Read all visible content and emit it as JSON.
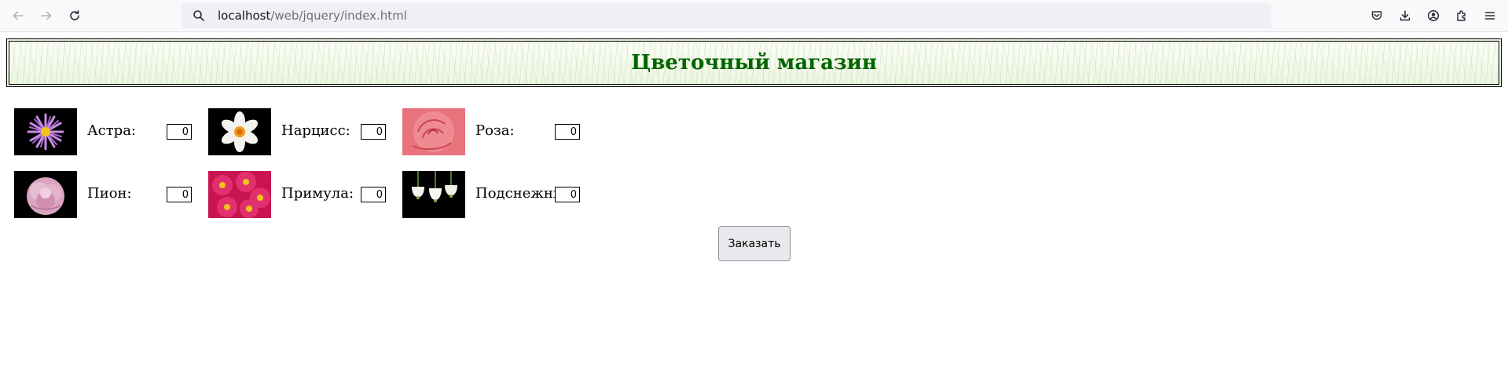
{
  "browser": {
    "url_host": "localhost",
    "url_path": "/web/jquery/index.html",
    "icons": [
      "back-arrow-icon",
      "forward-arrow-icon",
      "reload-icon",
      "search-icon",
      "pocket-icon",
      "download-icon",
      "account-icon",
      "extensions-icon",
      "menu-icon"
    ]
  },
  "page": {
    "title": "Цветочный магазин",
    "title_color": "#006400",
    "order_button": "Заказать",
    "flowers": [
      {
        "label": "Астра:",
        "value": "0",
        "image": "aster-flower"
      },
      {
        "label": "Нарцисс:",
        "value": "0",
        "image": "narcissus-flower"
      },
      {
        "label": "Роза:",
        "value": "0",
        "image": "rose-flower"
      },
      {
        "label": "Пион:",
        "value": "0",
        "image": "peony-flower"
      },
      {
        "label": "Примула:",
        "value": "0",
        "image": "primula-flower"
      },
      {
        "label": "Подснежник:",
        "value": "0",
        "image": "snowdrop-flower"
      }
    ]
  }
}
